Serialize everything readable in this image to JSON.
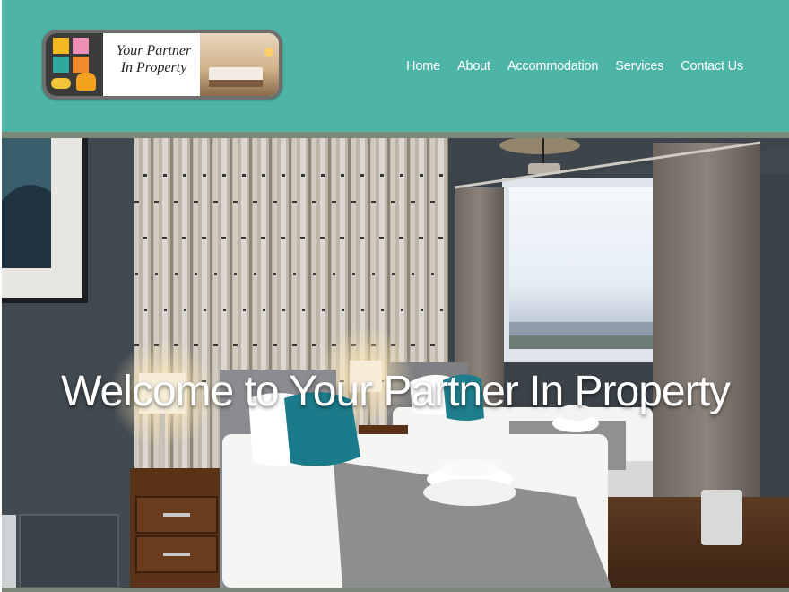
{
  "site": {
    "logo_text_line1": "Your Partner",
    "logo_text_line2": "In Property"
  },
  "nav": {
    "items": [
      {
        "label": "Home",
        "name": "nav-home"
      },
      {
        "label": "About",
        "name": "nav-about"
      },
      {
        "label": "Accommodation",
        "name": "nav-accommodation"
      },
      {
        "label": "Services",
        "name": "nav-services"
      },
      {
        "label": "Contact Us",
        "name": "nav-contact-us"
      }
    ]
  },
  "hero": {
    "title": "Welcome to Your Partner In Property"
  },
  "colors": {
    "header_bg": "#4cb5a6",
    "rule": "#7d8779",
    "text_light": "#ffffff"
  }
}
